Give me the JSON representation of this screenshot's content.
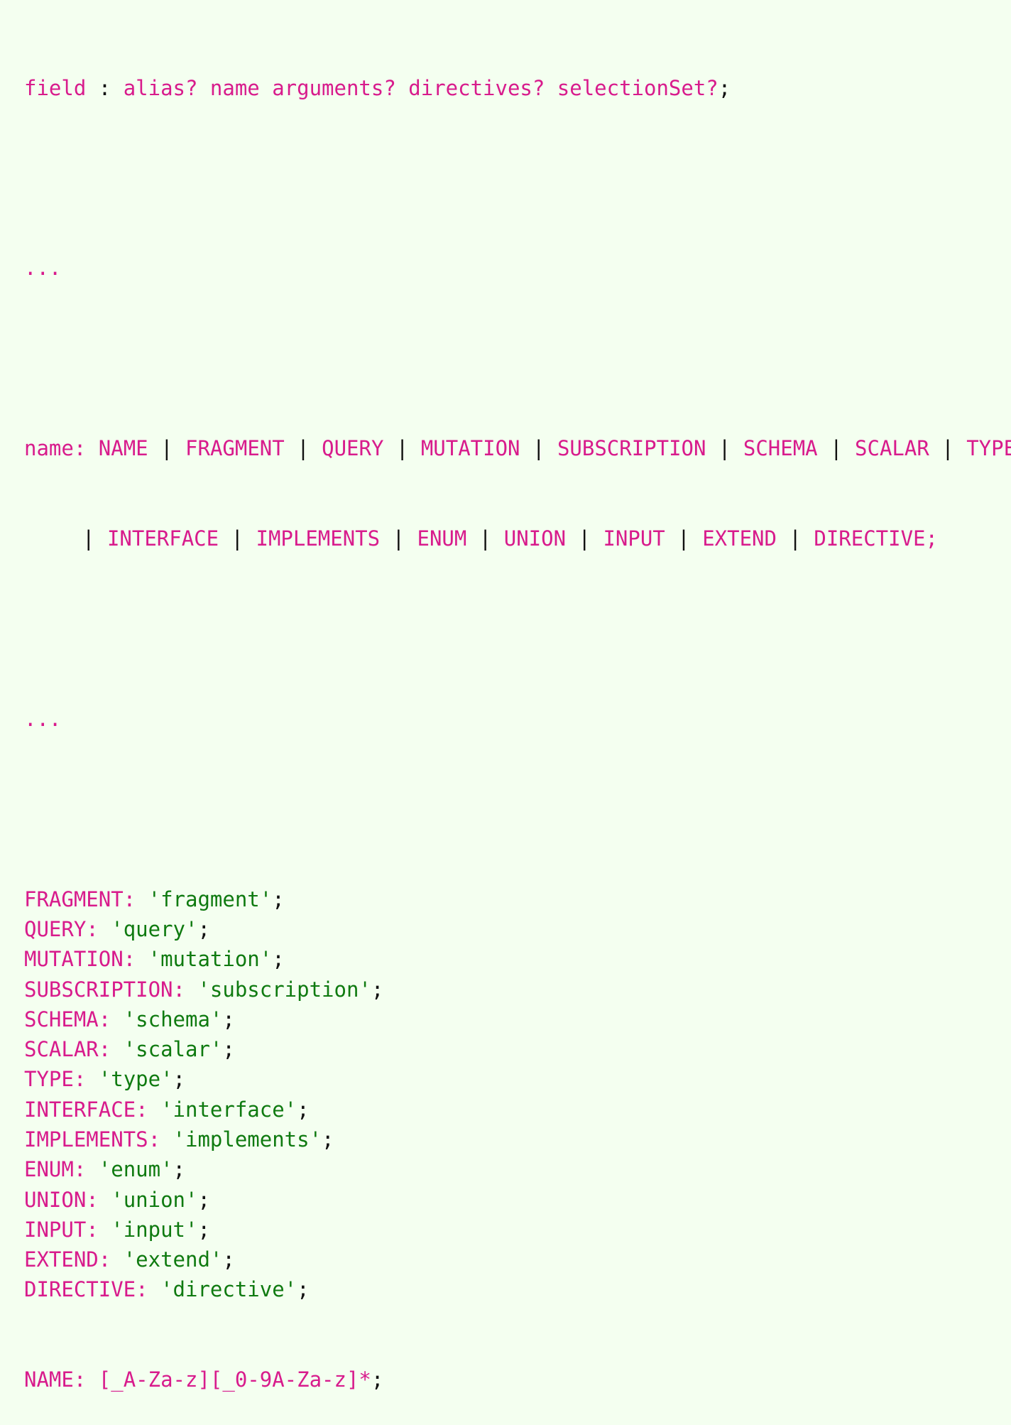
{
  "colors": {
    "background": "#f4fff0",
    "keyword": "#d81b8c",
    "string": "#0f7a10",
    "punctuation": "#111111"
  },
  "field_rule": {
    "name": "field",
    "sep": " : ",
    "body": "alias? name arguments? directives? selectionSet?",
    "end": ";"
  },
  "ellipsis_1": "...",
  "name_rule": {
    "head": "name:",
    "line1": [
      "NAME",
      "FRAGMENT",
      "QUERY",
      "MUTATION",
      "SUBSCRIPTION",
      "SCHEMA",
      "SCALAR",
      "TYPE"
    ],
    "line2": [
      "INTERFACE",
      "IMPLEMENTS",
      "ENUM",
      "UNION",
      "INPUT",
      "EXTEND",
      "DIRECTIVE"
    ],
    "pipe": "|",
    "end": ";"
  },
  "ellipsis_2": "...",
  "tokens": [
    {
      "name": "FRAGMENT:",
      "value": "'fragment'"
    },
    {
      "name": "QUERY:",
      "value": "'query'"
    },
    {
      "name": "MUTATION:",
      "value": "'mutation'"
    },
    {
      "name": "SUBSCRIPTION:",
      "value": "'subscription'"
    },
    {
      "name": "SCHEMA:",
      "value": "'schema'"
    },
    {
      "name": "SCALAR:",
      "value": "'scalar'"
    },
    {
      "name": "TYPE:",
      "value": "'type'"
    },
    {
      "name": "INTERFACE:",
      "value": "'interface'"
    },
    {
      "name": "IMPLEMENTS:",
      "value": "'implements'"
    },
    {
      "name": "ENUM:",
      "value": "'enum'"
    },
    {
      "name": "UNION:",
      "value": "'union'"
    },
    {
      "name": "INPUT:",
      "value": "'input'"
    },
    {
      "name": "EXTEND:",
      "value": "'extend'"
    },
    {
      "name": "DIRECTIVE:",
      "value": "'directive'"
    }
  ],
  "name_token": {
    "name": "NAME:",
    "value": "[_A-Za-z][_0-9A-Za-z]*",
    "end": ";"
  }
}
